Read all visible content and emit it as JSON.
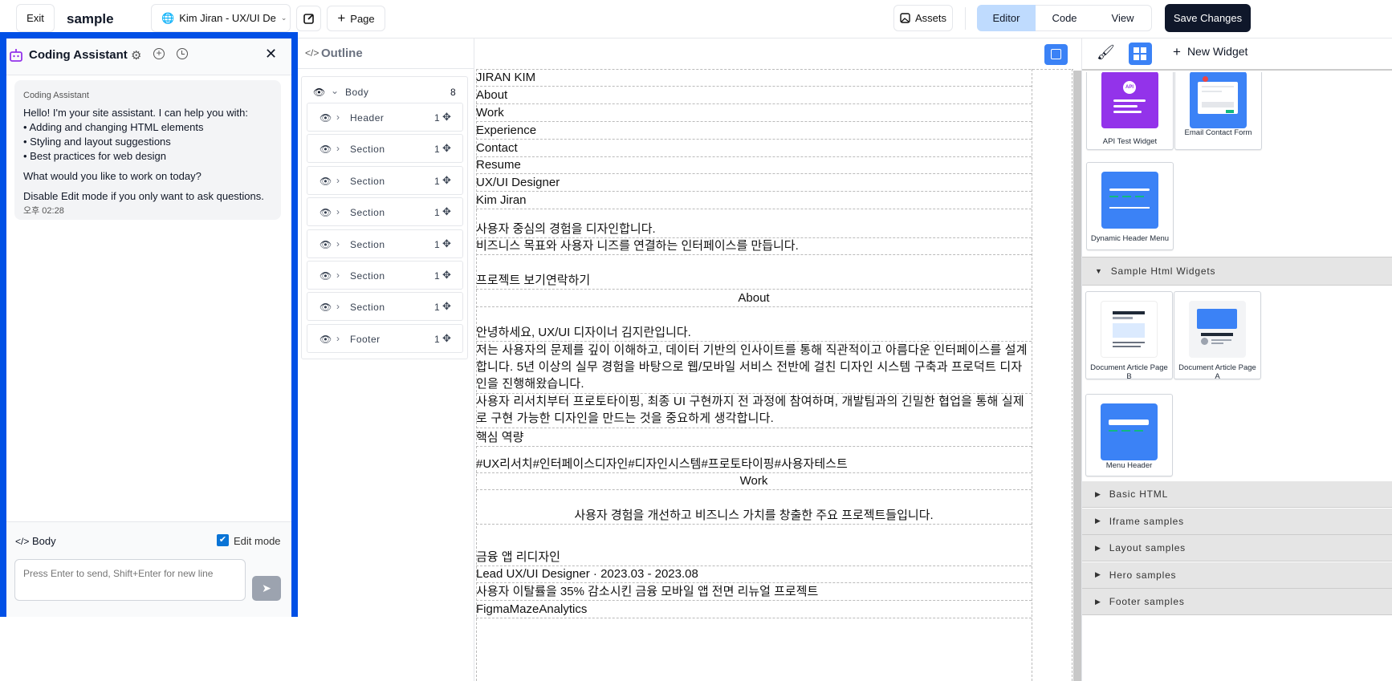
{
  "topbar": {
    "exit_label": "Exit",
    "site_name": "sample",
    "page_select": "Kim Jiran - UX/UI De",
    "add_page_label": "Page",
    "assets_label": "Assets",
    "modes": [
      "Editor",
      "Code",
      "View"
    ],
    "save_label": "Save Changes"
  },
  "assistant": {
    "title": "Coding Assistant",
    "message": {
      "sender": "Coding Assistant",
      "intro": "Hello! I'm your site assistant. I can help you with:",
      "bullets": [
        "• Adding and changing HTML elements",
        "• Styling and layout suggestions",
        "• Best practices for web design"
      ],
      "question": "What would you like to work on today?",
      "note": "Disable Edit mode if you only want to ask questions.",
      "time": "오후 02:28"
    },
    "context_label": "Body",
    "edit_mode_label": "Edit mode",
    "input_placeholder": "Press Enter to send, Shift+Enter for new line"
  },
  "outline": {
    "title": "Outline",
    "root": {
      "label": "Body",
      "count": "8"
    },
    "items": [
      {
        "label": "Header",
        "count": "1"
      },
      {
        "label": "Section",
        "count": "1"
      },
      {
        "label": "Section",
        "count": "1"
      },
      {
        "label": "Section",
        "count": "1"
      },
      {
        "label": "Section",
        "count": "1"
      },
      {
        "label": "Section",
        "count": "1"
      },
      {
        "label": "Section",
        "count": "1"
      },
      {
        "label": "Footer",
        "count": "1"
      }
    ]
  },
  "canvas": {
    "rows": [
      "JIRAN KIM",
      "About",
      "Work",
      "Experience",
      "Contact",
      "Resume",
      "UX/UI Designer",
      "Kim Jiran",
      "사용자 중심의 경험을 디자인합니다.",
      "비즈니스 목표와 사용자 니즈를 연결하는 인터페이스를 만듭니다.",
      "프로젝트 보기연락하기",
      "About",
      "안녕하세요, UX/UI 디자이너 김지란입니다.",
      "저는 사용자의 문제를 깊이 이해하고, 데이터 기반의 인사이트를 통해 직관적이고 아름다운 인터페이스를 설계합니다. 5년 이상의 실무 경험을 바탕으로 웹/모바일 서비스 전반에 걸친 디자인 시스템 구축과 프로덕트 디자인을 진행해왔습니다.",
      "사용자 리서치부터 프로토타이핑, 최종 UI 구현까지 전 과정에 참여하며, 개발팀과의 긴밀한 협업을 통해 실제로 구현 가능한 디자인을 만드는 것을 중요하게 생각합니다.",
      "핵심 역량",
      "#UX리서치#인터페이스디자인#디자인시스템#프로토타이핑#사용자테스트",
      "Work",
      "사용자 경험을 개선하고 비즈니스 가치를 창출한 주요 프로젝트들입니다.",
      "금융 앱 리디자인",
      "Lead UX/UI Designer · 2023.03 - 2023.08",
      "사용자 이탈률을 35% 감소시킨 금융 모바일 앱 전면 리뉴얼 프로젝트",
      "FigmaMazeAnalytics"
    ]
  },
  "widgets": {
    "new_widget_label": "New Widget",
    "top_cards": [
      "API Test Widget",
      "Email Contact Form",
      "Dynamic Header Menu"
    ],
    "api_badge": "API",
    "category_open": "Sample Html Widgets",
    "sample_cards": [
      "Document Article Page B",
      "Document Article Page A",
      "Menu Header"
    ],
    "categories": [
      "Basic HTML",
      "Iframe samples",
      "Layout samples",
      "Hero samples",
      "Footer samples"
    ]
  },
  "colors": {
    "accent": "#3b82f6",
    "highlight_border": "#0050e6",
    "save_bg": "#0f172a",
    "purple": "#9333ea"
  }
}
